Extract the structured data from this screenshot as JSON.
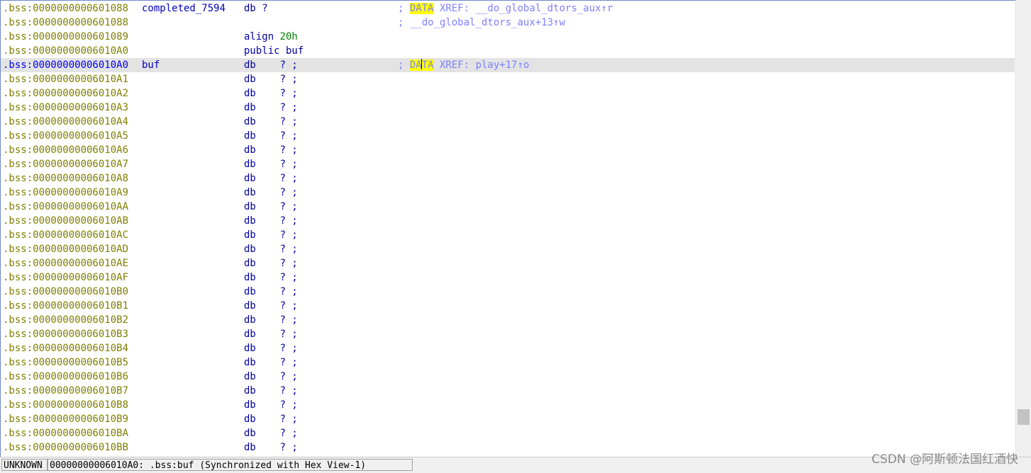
{
  "lines": [
    {
      "addr": ".bss:0000000000601088",
      "label": "completed_7594",
      "instr_html": "db ?",
      "comment_pre": "; ",
      "comment_hl": "DATA",
      "comment_post": " XREF: __do_global_dtors_aux↑r"
    },
    {
      "addr": ".bss:0000000000601088",
      "label": "",
      "instr_html": "",
      "comment_pre": "; __do_global_dtors_aux+13↑w",
      "comment_hl": "",
      "comment_post": ""
    },
    {
      "addr": ".bss:0000000000601089",
      "label": "",
      "instr_pre": "align ",
      "instr_num": "20h",
      "comment_pre": "",
      "comment_hl": "",
      "comment_post": ""
    },
    {
      "addr": ".bss:00000000006010A0",
      "label": "",
      "instr_html": "public buf",
      "comment_pre": "",
      "comment_hl": "",
      "comment_post": ""
    },
    {
      "addr": ".bss:00000000006010A0",
      "label": "buf",
      "instr_html": "db    ? ;",
      "comment_pre": "; ",
      "comment_hl_a": "DA",
      "comment_hl_b": "TA",
      "comment_post": " XREF: play+17↑o",
      "selected": true
    },
    {
      "addr": ".bss:00000000006010A1",
      "instr_html": "db    ? ;"
    },
    {
      "addr": ".bss:00000000006010A2",
      "instr_html": "db    ? ;"
    },
    {
      "addr": ".bss:00000000006010A3",
      "instr_html": "db    ? ;"
    },
    {
      "addr": ".bss:00000000006010A4",
      "instr_html": "db    ? ;"
    },
    {
      "addr": ".bss:00000000006010A5",
      "instr_html": "db    ? ;"
    },
    {
      "addr": ".bss:00000000006010A6",
      "instr_html": "db    ? ;"
    },
    {
      "addr": ".bss:00000000006010A7",
      "instr_html": "db    ? ;"
    },
    {
      "addr": ".bss:00000000006010A8",
      "instr_html": "db    ? ;"
    },
    {
      "addr": ".bss:00000000006010A9",
      "instr_html": "db    ? ;"
    },
    {
      "addr": ".bss:00000000006010AA",
      "instr_html": "db    ? ;"
    },
    {
      "addr": ".bss:00000000006010AB",
      "instr_html": "db    ? ;"
    },
    {
      "addr": ".bss:00000000006010AC",
      "instr_html": "db    ? ;"
    },
    {
      "addr": ".bss:00000000006010AD",
      "instr_html": "db    ? ;"
    },
    {
      "addr": ".bss:00000000006010AE",
      "instr_html": "db    ? ;"
    },
    {
      "addr": ".bss:00000000006010AF",
      "instr_html": "db    ? ;"
    },
    {
      "addr": ".bss:00000000006010B0",
      "instr_html": "db    ? ;"
    },
    {
      "addr": ".bss:00000000006010B1",
      "instr_html": "db    ? ;"
    },
    {
      "addr": ".bss:00000000006010B2",
      "instr_html": "db    ? ;"
    },
    {
      "addr": ".bss:00000000006010B3",
      "instr_html": "db    ? ;"
    },
    {
      "addr": ".bss:00000000006010B4",
      "instr_html": "db    ? ;"
    },
    {
      "addr": ".bss:00000000006010B5",
      "instr_html": "db    ? ;"
    },
    {
      "addr": ".bss:00000000006010B6",
      "instr_html": "db    ? ;"
    },
    {
      "addr": ".bss:00000000006010B7",
      "instr_html": "db    ? ;"
    },
    {
      "addr": ".bss:00000000006010B8",
      "instr_html": "db    ? ;"
    },
    {
      "addr": ".bss:00000000006010B9",
      "instr_html": "db    ? ;"
    },
    {
      "addr": ".bss:00000000006010BA",
      "instr_html": "db    ? ;"
    },
    {
      "addr": ".bss:00000000006010BB",
      "instr_html": "db    ? ;"
    }
  ],
  "statusbar": {
    "mode": "UNKNOWN",
    "location": "00000000006010A0: .bss:buf (Synchronized with Hex View-1)"
  },
  "watermark": "CSDN @阿斯顿法国红酒快",
  "scrollbar": {
    "position_fraction": 0.93
  }
}
